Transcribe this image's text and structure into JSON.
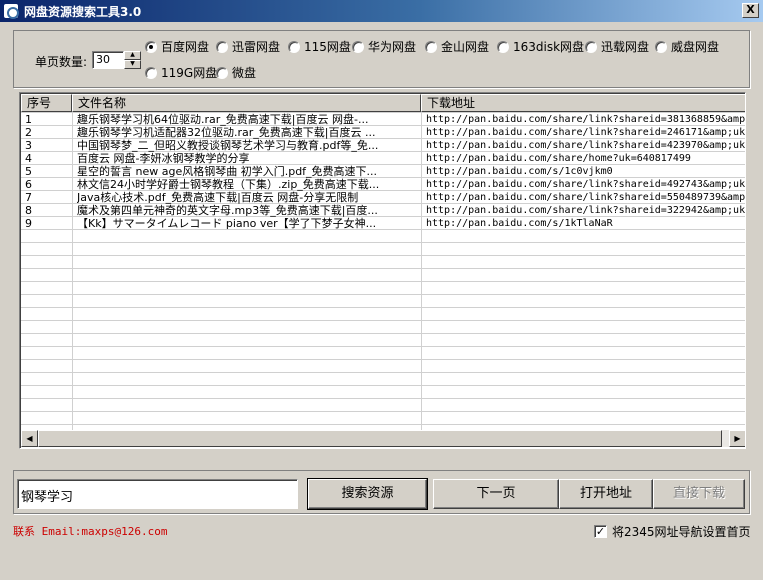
{
  "window": {
    "title": "网盘资源搜索工具3.0",
    "close_glyph": "X"
  },
  "options": {
    "page_size_label": "单页数量:",
    "page_size_value": "30",
    "spin_up": "▲",
    "spin_down": "▼",
    "providers": [
      {
        "label": "百度网盘",
        "checked": true
      },
      {
        "label": "迅雷网盘",
        "checked": false
      },
      {
        "label": "115网盘",
        "checked": false
      },
      {
        "label": "华为网盘",
        "checked": false
      },
      {
        "label": "金山网盘",
        "checked": false
      },
      {
        "label": "163disk网盘",
        "checked": false
      },
      {
        "label": "迅载网盘",
        "checked": false
      },
      {
        "label": "威盘网盘",
        "checked": false
      },
      {
        "label": "119G网盘",
        "checked": false
      },
      {
        "label": "微盘",
        "checked": false
      }
    ]
  },
  "results": {
    "columns": [
      "序号",
      "文件名称",
      "下载地址"
    ],
    "rows": [
      {
        "no": "1",
        "name": "趣乐钢琴学习机64位驱动.rar_免费高速下载|百度云 网盘-...",
        "url": "http://pan.baidu.com/share/link?shareid=381368859&amp;uk"
      },
      {
        "no": "2",
        "name": "趣乐钢琴学习机适配器32位驱动.rar_免费高速下载|百度云 ...",
        "url": "http://pan.baidu.com/share/link?shareid=246171&amp;uk"
      },
      {
        "no": "3",
        "name": "中国钢琴梦_二_但昭义教授谈钢琴艺术学习与教育.pdf等_免...",
        "url": "http://pan.baidu.com/share/link?shareid=423970&amp;uk"
      },
      {
        "no": "4",
        "name": "百度云 网盘-李妍冰钢琴教学的分享",
        "url": "http://pan.baidu.com/share/home?uk=640817499"
      },
      {
        "no": "5",
        "name": "星空的誓言 new age风格钢琴曲 初学入门.pdf_免费高速下...",
        "url": "http://pan.baidu.com/s/1c0vjkm0"
      },
      {
        "no": "6",
        "name": "林文信24小时学好爵士钢琴教程（下集）.zip_免费高速下载...",
        "url": "http://pan.baidu.com/share/link?shareid=492743&amp;uk"
      },
      {
        "no": "7",
        "name": "Java核心技术.pdf_免费高速下载|百度云 网盘-分享无限制",
        "url": "http://pan.baidu.com/share/link?shareid=550489739&amp"
      },
      {
        "no": "8",
        "name": "魔术及第四单元神奇的英文字母.mp3等_免费高速下载|百度...",
        "url": "http://pan.baidu.com/share/link?shareid=322942&amp;uk"
      },
      {
        "no": "9",
        "name": "【Kk】サマータイムレコード piano ver【学了下梦子女神...",
        "url": "http://pan.baidu.com/s/1kTlaNaR"
      }
    ],
    "scroll_left": "◀",
    "scroll_right": "▶"
  },
  "search": {
    "query": "钢琴学习",
    "buttons": {
      "search": "搜索资源",
      "next": "下一页",
      "open": "打开地址",
      "direct": "直接下载"
    }
  },
  "footer": {
    "contact": "联系 Email:maxps@126.com",
    "homepage_checked": true,
    "check_glyph": "✓",
    "homepage_label": "将2345网址导航设置首页"
  }
}
